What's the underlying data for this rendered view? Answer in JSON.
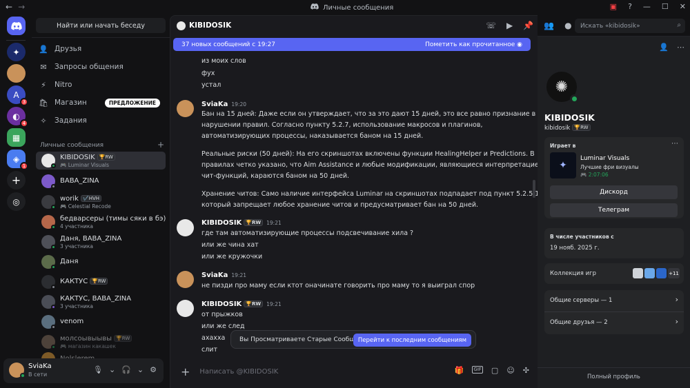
{
  "titlebar": {
    "title": "Личные сообщения"
  },
  "sidebar": {
    "search_label": "Найти или начать беседу",
    "nav": [
      {
        "label": "Друзья",
        "icon": "friends-icon"
      },
      {
        "label": "Запросы общения",
        "icon": "inbox-icon"
      },
      {
        "label": "Nitro",
        "icon": "nitro-icon"
      },
      {
        "label": "Магазин",
        "icon": "shop-icon",
        "badge": "ПРЕДЛОЖЕНИЕ"
      },
      {
        "label": "Задания",
        "icon": "quests-icon"
      }
    ],
    "dm_section": "Личные сообщения",
    "dm_add": "+",
    "dms": [
      {
        "name": "KIBIDOSIK",
        "tag": "🏆RW",
        "sub": "🎮 Luminar Visuals"
      },
      {
        "name": "BABA_ZINA",
        "tag": "",
        "sub": ""
      },
      {
        "name": "worik",
        "tag": "✔️HVH",
        "sub": "🎮 Celestial Recode"
      },
      {
        "name": "бедварсеры (тимы сяки в бэ)",
        "tag": "",
        "sub": "4 участника"
      },
      {
        "name": "Даня, BABA_ZINA",
        "tag": "",
        "sub": "3 участника"
      },
      {
        "name": "Даня",
        "tag": "",
        "sub": ""
      },
      {
        "name": "КАКТУС",
        "tag": "🏆RW",
        "sub": ""
      },
      {
        "name": "КАКТУС, BABA_ZINA",
        "tag": "",
        "sub": "3 участника"
      },
      {
        "name": "venom",
        "tag": "",
        "sub": ""
      },
      {
        "name": "молсоывыывы",
        "tag": "🏆RW",
        "sub": "🎮 магазин какашек"
      },
      {
        "name": "Nolslerem",
        "tag": "",
        "sub": ""
      }
    ]
  },
  "user": {
    "name": "SviaKa",
    "status": "В сети"
  },
  "server_badges": [
    "3",
    "4",
    "1"
  ],
  "chat": {
    "header_name": "KIBIDOSIK",
    "search_placeholder": "Искать «kibidosik»",
    "new_bar": "37 новых сообщений с 19:27",
    "mark_read": "Пометить как прочитанное",
    "top_lines": [
      "из моих слов",
      "фух",
      "устал"
    ],
    "messages": [
      {
        "author": "SviaKa",
        "tag": "",
        "time": "19:20",
        "lines": [
          "Бан на 15 дней: Даже если он утверждает, что за это дают 15 дней, это все равно признание в",
          "нарушении правил. Согласно пункту 5.2.7, использование макросов и плагинов,",
          "автоматизирующих процессы, наказывается баном на 15 дней.",
          "",
          "Реальные риски (50 дней): На его скриншотах включены функции HealingHelper и Predictions. В",
          "правилах четко указано, что Aim Assistance и любые модификации, являющиеся интерпретацией",
          "чит-функций, караются баном на 50 дней.",
          "",
          "Хранение читов: Само наличие интерфейса Luminar на скриншотах подпадает под пункт 5.2.5.1,",
          "который запрещает любое хранение читов и предусматривает бан на 50 дней."
        ]
      },
      {
        "author": "KIBIDOSIK",
        "tag": "🏆RW",
        "time": "19:21",
        "lines": [
          "где там автоматизирующие процессы подсвечивание хила ?",
          "или же чина хат",
          "или же кружочки"
        ]
      },
      {
        "author": "SviaKa",
        "tag": "",
        "time": "19:21",
        "lines": [
          "не пизди про маму если ктот оначинате говорить про маму то я выиграл спор"
        ]
      },
      {
        "author": "KIBIDOSIK",
        "tag": "🏆RW",
        "time": "19:21",
        "lines": [
          "от прыжков",
          "или же след",
          "ахахха",
          "слит"
        ]
      }
    ],
    "old_notice": "Вы Просматриваете Старые Сообщения",
    "jump_button": "Перейти к последним сообщениям",
    "composer_placeholder": "Написать @KIBIDOSIK"
  },
  "profile": {
    "name": "KIBIDOSIK",
    "handle": "kibidosik",
    "tag": "🏆RW",
    "playing_label": "Играет в",
    "game": "Luminar Visuals",
    "game_desc": "Лучшие фри визуалы",
    "game_time": "2:07:06",
    "btn_discord": "Дискорд",
    "btn_telegram": "Телеграм",
    "member_label": "В числе участников с",
    "member_date": "19 нояб. 2025 г.",
    "collection": "Коллекция игр",
    "collection_more": "+11",
    "mutual_servers": "Общие серверы — 1",
    "mutual_friends": "Общие друзья — 2",
    "full_profile": "Полный профиль"
  },
  "colors": {
    "accent": "#5865f2",
    "online": "#23a55a",
    "danger": "#f23f43"
  }
}
